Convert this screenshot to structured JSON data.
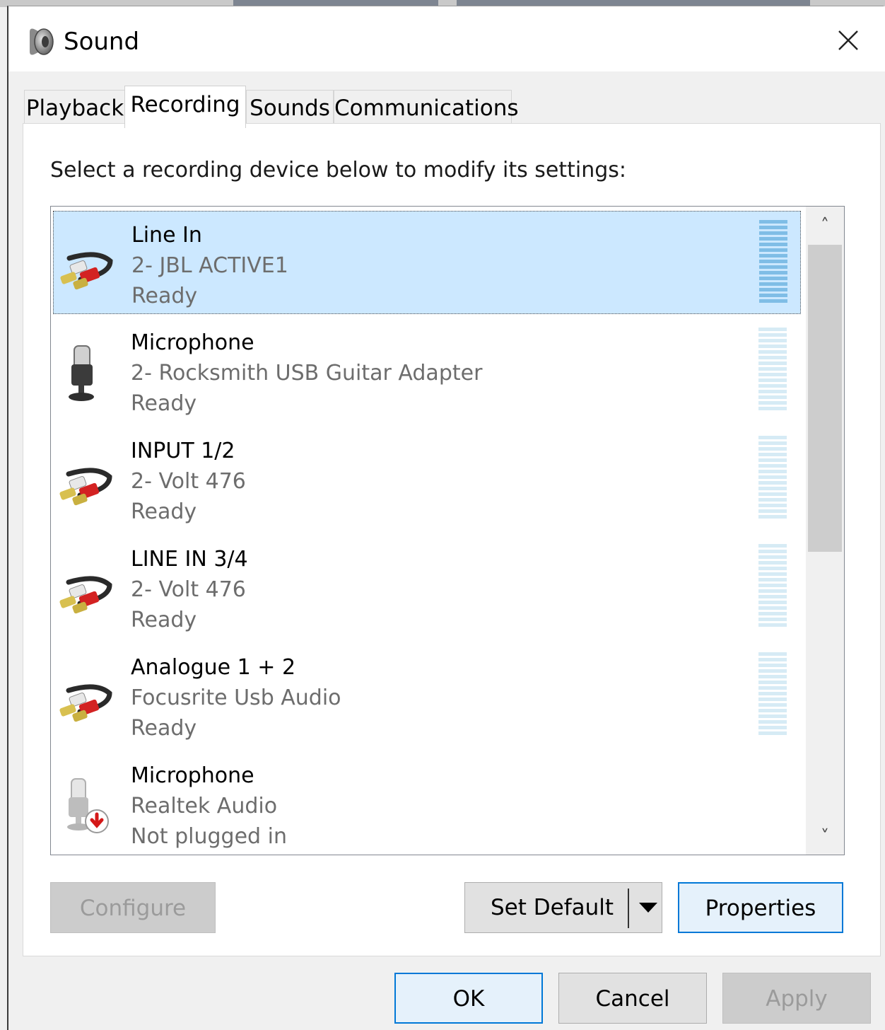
{
  "window": {
    "title": "Sound",
    "icon": "speaker-icon",
    "close_icon": "close-icon"
  },
  "tabs": [
    {
      "label": "Playback",
      "active": false
    },
    {
      "label": "Recording",
      "active": true
    },
    {
      "label": "Sounds",
      "active": false
    },
    {
      "label": "Communications",
      "active": false
    }
  ],
  "recording": {
    "instruction": "Select a recording device below to modify its settings:",
    "devices": [
      {
        "name": "Line In",
        "description": "2- JBL ACTIVE1",
        "status": "Ready",
        "icon": "line-in-cable-icon",
        "selected": true
      },
      {
        "name": "Microphone",
        "description": "2- Rocksmith USB Guitar Adapter",
        "status": "Ready",
        "icon": "microphone-icon",
        "selected": false
      },
      {
        "name": "INPUT 1/2",
        "description": "2- Volt 476",
        "status": "Ready",
        "icon": "line-in-cable-icon",
        "selected": false
      },
      {
        "name": "LINE IN 3/4",
        "description": "2- Volt 476",
        "status": "Ready",
        "icon": "line-in-cable-icon",
        "selected": false
      },
      {
        "name": "Analogue 1 + 2",
        "description": "Focusrite Usb Audio",
        "status": "Ready",
        "icon": "line-in-cable-icon",
        "selected": false
      },
      {
        "name": "Microphone",
        "description": "Realtek Audio",
        "status": "Not plugged in",
        "icon": "microphone-unplugged-icon",
        "selected": false
      }
    ],
    "scroll_up_glyph": "˄",
    "scroll_down_glyph": "˅"
  },
  "buttons": {
    "configure": "Configure",
    "set_default": "Set Default",
    "properties": "Properties",
    "ok": "OK",
    "cancel": "Cancel",
    "apply": "Apply"
  },
  "colors": {
    "selection": "#cce8ff",
    "focus_border": "#0078d7",
    "meter": "#d6ebf5"
  }
}
